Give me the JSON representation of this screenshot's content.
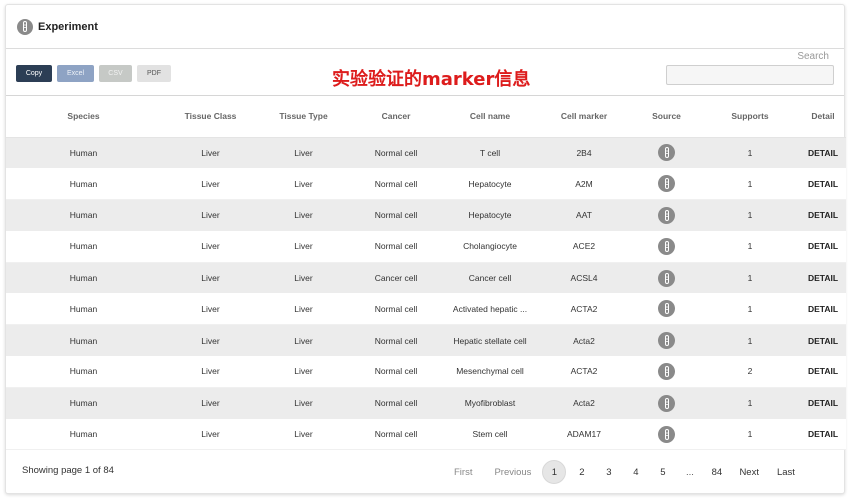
{
  "header": {
    "title": "Experiment",
    "icon": "dna-tube-icon"
  },
  "toolbar": {
    "copy": "Copy",
    "excel": "Excel",
    "csv": "CSV",
    "pdf": "PDF"
  },
  "banner": {
    "text": "实验验证的marker信息",
    "color": "#dd1c1c"
  },
  "search": {
    "label": "Search",
    "value": ""
  },
  "table": {
    "columns": [
      "Species",
      "Tissue Class",
      "Tissue Type",
      "Cancer",
      "Cell name",
      "Cell marker",
      "Source",
      "Supports",
      "Detail"
    ],
    "rows": [
      {
        "species": "Human",
        "tissue_class": "Liver",
        "tissue_type": "Liver",
        "cancer": "Normal cell",
        "cell_name": "T cell",
        "cell_marker": "2B4",
        "source_icon": "dna-tube-icon",
        "supports": "1",
        "detail": "DETAIL"
      },
      {
        "species": "Human",
        "tissue_class": "Liver",
        "tissue_type": "Liver",
        "cancer": "Normal cell",
        "cell_name": "Hepatocyte",
        "cell_marker": "A2M",
        "source_icon": "dna-tube-icon",
        "supports": "1",
        "detail": "DETAIL"
      },
      {
        "species": "Human",
        "tissue_class": "Liver",
        "tissue_type": "Liver",
        "cancer": "Normal cell",
        "cell_name": "Hepatocyte",
        "cell_marker": "AAT",
        "source_icon": "dna-tube-icon",
        "supports": "1",
        "detail": "DETAIL"
      },
      {
        "species": "Human",
        "tissue_class": "Liver",
        "tissue_type": "Liver",
        "cancer": "Normal cell",
        "cell_name": "Cholangiocyte",
        "cell_marker": "ACE2",
        "source_icon": "dna-tube-icon",
        "supports": "1",
        "detail": "DETAIL"
      },
      {
        "species": "Human",
        "tissue_class": "Liver",
        "tissue_type": "Liver",
        "cancer": "Cancer cell",
        "cell_name": "Cancer cell",
        "cell_marker": "ACSL4",
        "source_icon": "dna-tube-icon",
        "supports": "1",
        "detail": "DETAIL"
      },
      {
        "species": "Human",
        "tissue_class": "Liver",
        "tissue_type": "Liver",
        "cancer": "Normal cell",
        "cell_name": "Activated hepatic ...",
        "cell_marker": "ACTA2",
        "source_icon": "dna-tube-icon",
        "supports": "1",
        "detail": "DETAIL"
      },
      {
        "species": "Human",
        "tissue_class": "Liver",
        "tissue_type": "Liver",
        "cancer": "Normal cell",
        "cell_name": "Hepatic stellate cell",
        "cell_marker": "Acta2",
        "source_icon": "dna-tube-icon",
        "supports": "1",
        "detail": "DETAIL"
      },
      {
        "species": "Human",
        "tissue_class": "Liver",
        "tissue_type": "Liver",
        "cancer": "Normal cell",
        "cell_name": "Mesenchymal cell",
        "cell_marker": "ACTA2",
        "source_icon": "dna-tube-icon",
        "supports": "2",
        "detail": "DETAIL"
      },
      {
        "species": "Human",
        "tissue_class": "Liver",
        "tissue_type": "Liver",
        "cancer": "Normal cell",
        "cell_name": "Myofibroblast",
        "cell_marker": "Acta2",
        "source_icon": "dna-tube-icon",
        "supports": "1",
        "detail": "DETAIL"
      },
      {
        "species": "Human",
        "tissue_class": "Liver",
        "tissue_type": "Liver",
        "cancer": "Normal cell",
        "cell_name": "Stem cell",
        "cell_marker": "ADAM17",
        "source_icon": "dna-tube-icon",
        "supports": "1",
        "detail": "DETAIL"
      }
    ]
  },
  "footer": {
    "info": "Showing page 1 of 84",
    "pagination": {
      "first": "First",
      "previous": "Previous",
      "pages": [
        "1",
        "2",
        "3",
        "4",
        "5"
      ],
      "active": "1",
      "ellipsis": "...",
      "last_page": "84",
      "next": "Next",
      "last": "Last"
    }
  },
  "colors": {
    "active_page_bg": "#e6e6e6",
    "stripe": "#ececec",
    "copy_button": "#2c3e55",
    "excel_button": "#8ea3c4"
  }
}
